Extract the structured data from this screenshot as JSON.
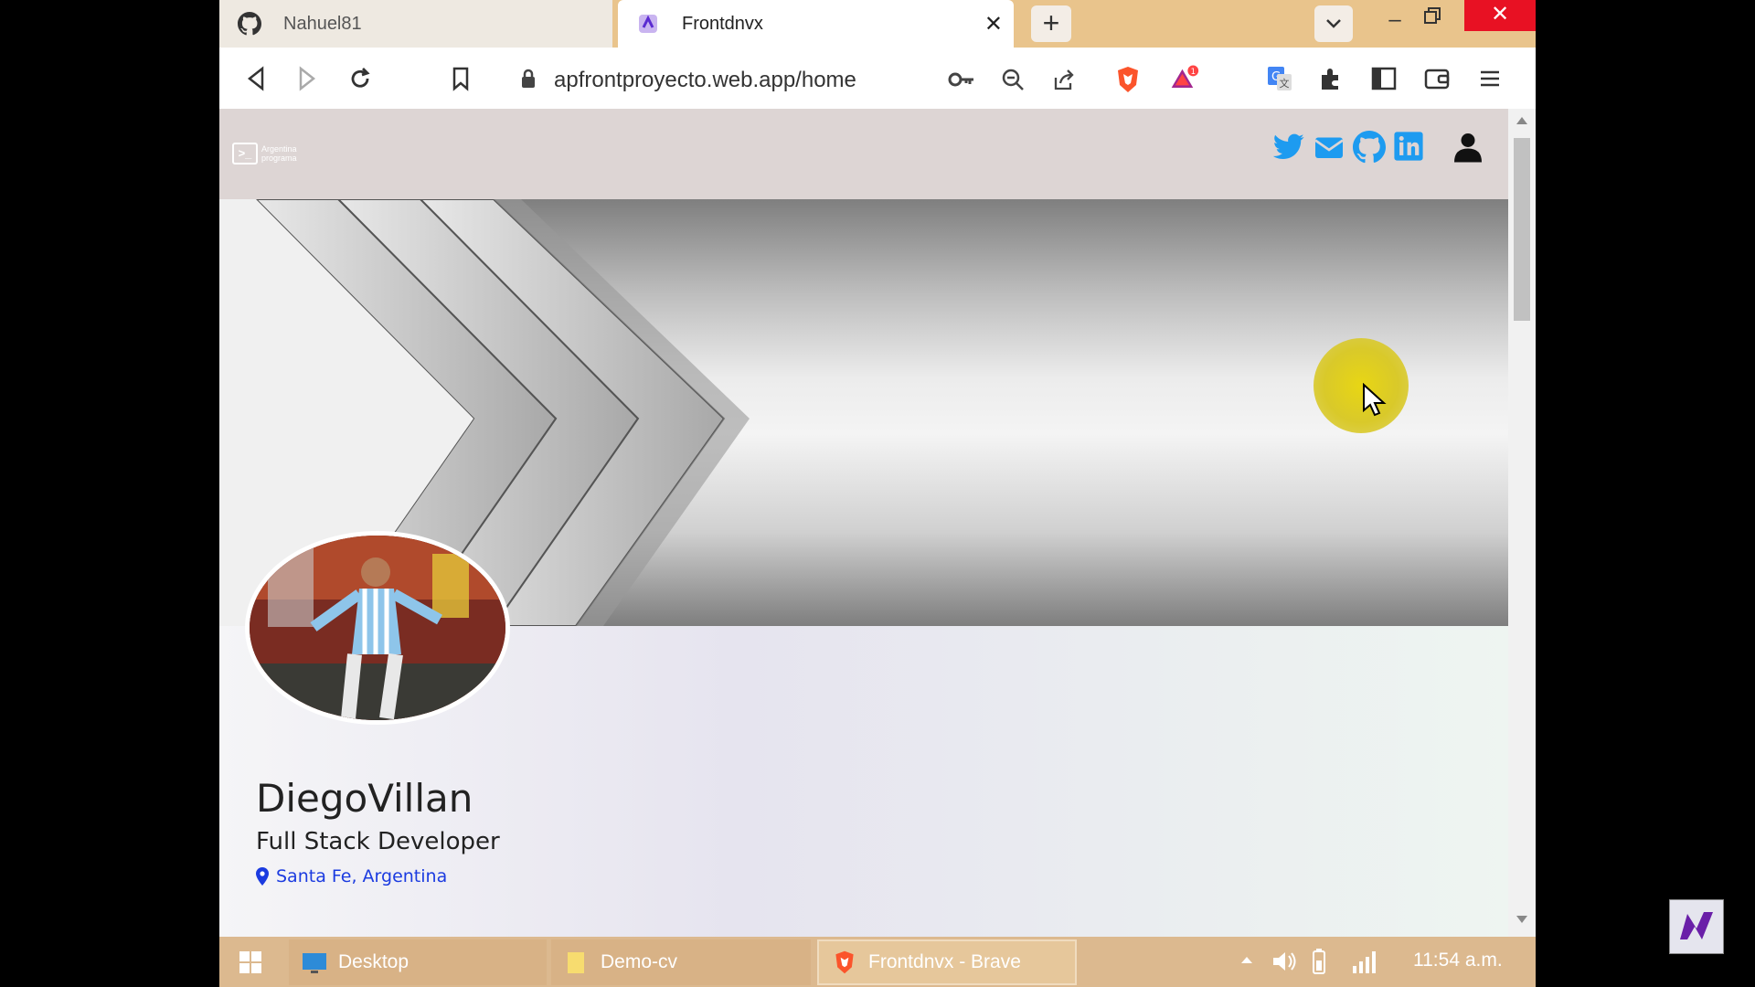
{
  "browser": {
    "tabs": [
      {
        "title": "Nahuel81",
        "icon": "github-icon",
        "active": false
      },
      {
        "title": "Frontdnvx",
        "icon": "app-icon",
        "active": true
      }
    ],
    "address": "apfrontproyecto.web.app/home"
  },
  "site": {
    "logo_text_line1": "Argentina",
    "logo_text_line2": "programa",
    "social_icons": [
      "twitter-icon",
      "email-icon",
      "github-icon",
      "linkedin-icon",
      "user-icon"
    ],
    "colors": {
      "social": "#1d9bf0",
      "location": "#1b3be0"
    }
  },
  "profile": {
    "name": "DiegoVillan",
    "title": "Full Stack Developer",
    "location": "Santa Fe, Argentina"
  },
  "taskbar": {
    "items": [
      {
        "label": "Desktop"
      },
      {
        "label": "Demo-cv"
      },
      {
        "label": "Frontdnvx - Brave"
      }
    ],
    "clock": "11:54 a.m."
  }
}
